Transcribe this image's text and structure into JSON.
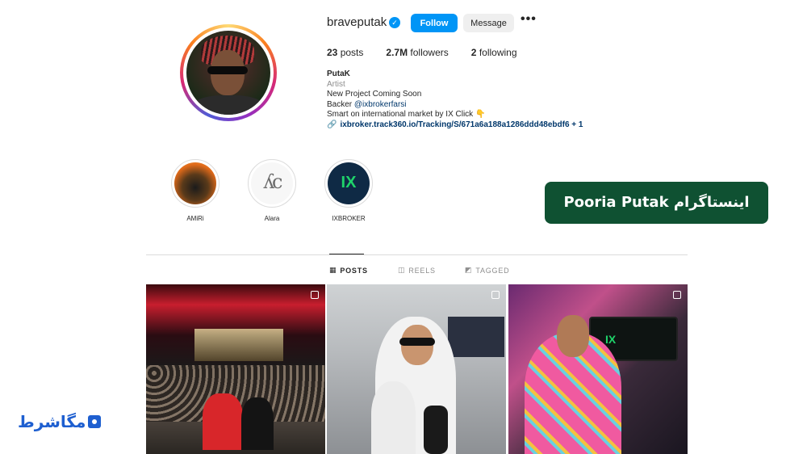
{
  "profile": {
    "username": "braveputak",
    "follow_label": "Follow",
    "message_label": "Message",
    "more_glyph": "•••",
    "verified_glyph": "✓",
    "stats": {
      "posts_count": "23",
      "posts_label": "posts",
      "followers_count": "2.7M",
      "followers_label": "followers",
      "following_count": "2",
      "following_label": "following"
    },
    "bio": {
      "name": "PutaK",
      "category": "Artist",
      "line1": "New Project Coming Soon",
      "line2_prefix": "Backer ",
      "line2_mention": "@ixbrokerfarsi",
      "line3": "Smart on international market by IX Click 👇",
      "link": "ixbroker.track360.io/Tracking/S/671a6a188a1286ddd48ebdf6 + 1"
    }
  },
  "highlights": [
    {
      "label": "AMiRi"
    },
    {
      "label": "Alara",
      "logo_text": "ʎc"
    },
    {
      "label": "IXBROKER",
      "logo_text": "IX"
    }
  ],
  "tabs": [
    {
      "label": "POSTS",
      "icon": "grid-icon",
      "glyph": "▦",
      "active": true
    },
    {
      "label": "REELS",
      "icon": "reels-icon",
      "glyph": "◫",
      "active": false
    },
    {
      "label": "TAGGED",
      "icon": "tagged-icon",
      "glyph": "◩",
      "active": false
    }
  ],
  "posts": {
    "monitor_text": "IX"
  },
  "overlay": {
    "banner_text": "اینستاگرام  Pooria Putak",
    "logo_text": "مگاشرط"
  },
  "colors": {
    "follow_button": "#0095f6",
    "banner_bg": "#0f5132",
    "logo": "#1e5fd0"
  }
}
